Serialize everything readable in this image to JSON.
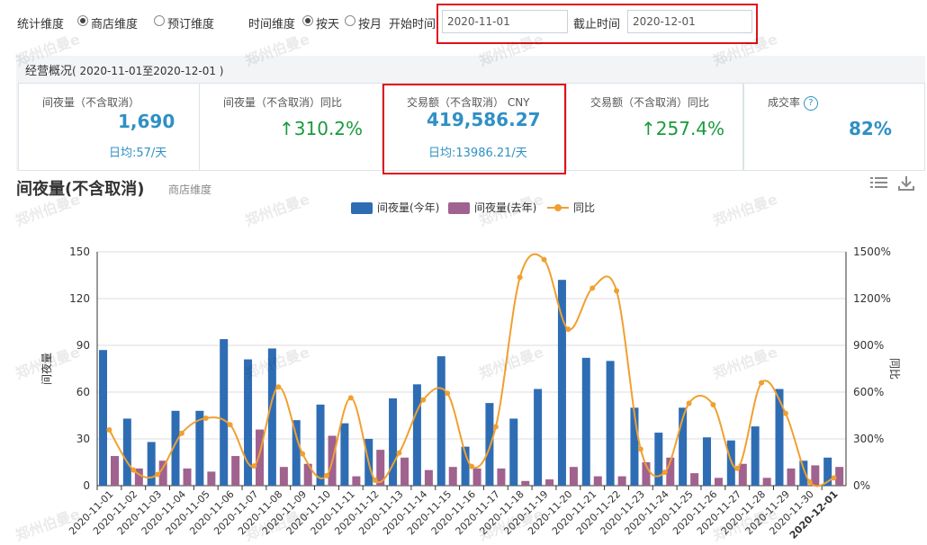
{
  "filters": {
    "stat_dim_label": "统计维度",
    "stat_opt1": "商店维度",
    "stat_opt2": "预订维度",
    "time_dim_label": "时间维度",
    "time_opt1": "按天",
    "time_opt2": "按月",
    "start_label": "开始时间",
    "start_value": "2020-11-01",
    "end_label": "截止时间",
    "end_value": "2020-12-01"
  },
  "summary": {
    "title": "经营概况",
    "range": "( 2020-11-01至2020-12-01 )",
    "cards": [
      {
        "title": "间夜量（不含取消）",
        "value": "1,690",
        "sub": "日均:57/天"
      },
      {
        "title": "间夜量（不含取消）同比",
        "value": "310.2%"
      },
      {
        "title": "交易额（不含取消） CNY",
        "value": "419,586.27",
        "sub": "日均:13986.21/天"
      },
      {
        "title": "交易额（不含取消）同比",
        "value": "257.4%"
      },
      {
        "title": "成交率",
        "value": "82%"
      }
    ]
  },
  "chart_header": {
    "title": "间夜量(不含取消)",
    "subtitle": "商店维度"
  },
  "watermark": "郑州伯曼e",
  "colors": {
    "this_year": "#2e6db4",
    "last_year": "#a0628e",
    "yoy": "#f0a030",
    "highlight": "#e0101b"
  },
  "chart_data": {
    "type": "bar",
    "categories": [
      "2020-11-01",
      "2020-11-02",
      "2020-11-03",
      "2020-11-04",
      "2020-11-05",
      "2020-11-06",
      "2020-11-07",
      "2020-11-08",
      "2020-11-09",
      "2020-11-10",
      "2020-11-11",
      "2020-11-12",
      "2020-11-13",
      "2020-11-14",
      "2020-11-15",
      "2020-11-16",
      "2020-11-17",
      "2020-11-18",
      "2020-11-19",
      "2020-11-20",
      "2020-11-21",
      "2020-11-22",
      "2020-11-23",
      "2020-11-24",
      "2020-11-25",
      "2020-11-26",
      "2020-11-27",
      "2020-11-28",
      "2020-11-29",
      "2020-11-30",
      "2020-12-01"
    ],
    "series": [
      {
        "name": "间夜量(今年)",
        "type": "bar",
        "axis": "left",
        "values": [
          87,
          43,
          28,
          48,
          48,
          94,
          81,
          88,
          42,
          52,
          40,
          30,
          56,
          65,
          83,
          25,
          53,
          43,
          62,
          132,
          82,
          80,
          50,
          34,
          50,
          31,
          29,
          38,
          62,
          16,
          18
        ]
      },
      {
        "name": "间夜量(去年)",
        "type": "bar",
        "axis": "left",
        "values": [
          19,
          11,
          16,
          11,
          9,
          19,
          36,
          12,
          14,
          32,
          6,
          23,
          18,
          10,
          12,
          11,
          11,
          3,
          4,
          12,
          6,
          6,
          15,
          18,
          8,
          5,
          14,
          5,
          11,
          13,
          12
        ]
      },
      {
        "name": "同比",
        "type": "line",
        "axis": "right",
        "values": [
          358,
          100,
          72,
          336,
          433,
          391,
          126,
          633,
          204,
          64,
          563,
          35,
          210,
          550,
          592,
          123,
          377,
          1336,
          1450,
          1003,
          1267,
          1250,
          234,
          86,
          528,
          519,
          111,
          660,
          464,
          23,
          50
        ]
      }
    ],
    "ylabel": "间夜量",
    "y2label": "同比",
    "ylim": [
      0,
      150
    ],
    "y2lim": [
      0,
      1500
    ],
    "yticks": [
      "0",
      "30",
      "60",
      "90",
      "120",
      "150"
    ],
    "y2ticks": [
      "0%",
      "300%",
      "600%",
      "900%",
      "1200%",
      "1500%"
    ],
    "grid": true,
    "legend": "top-center"
  }
}
